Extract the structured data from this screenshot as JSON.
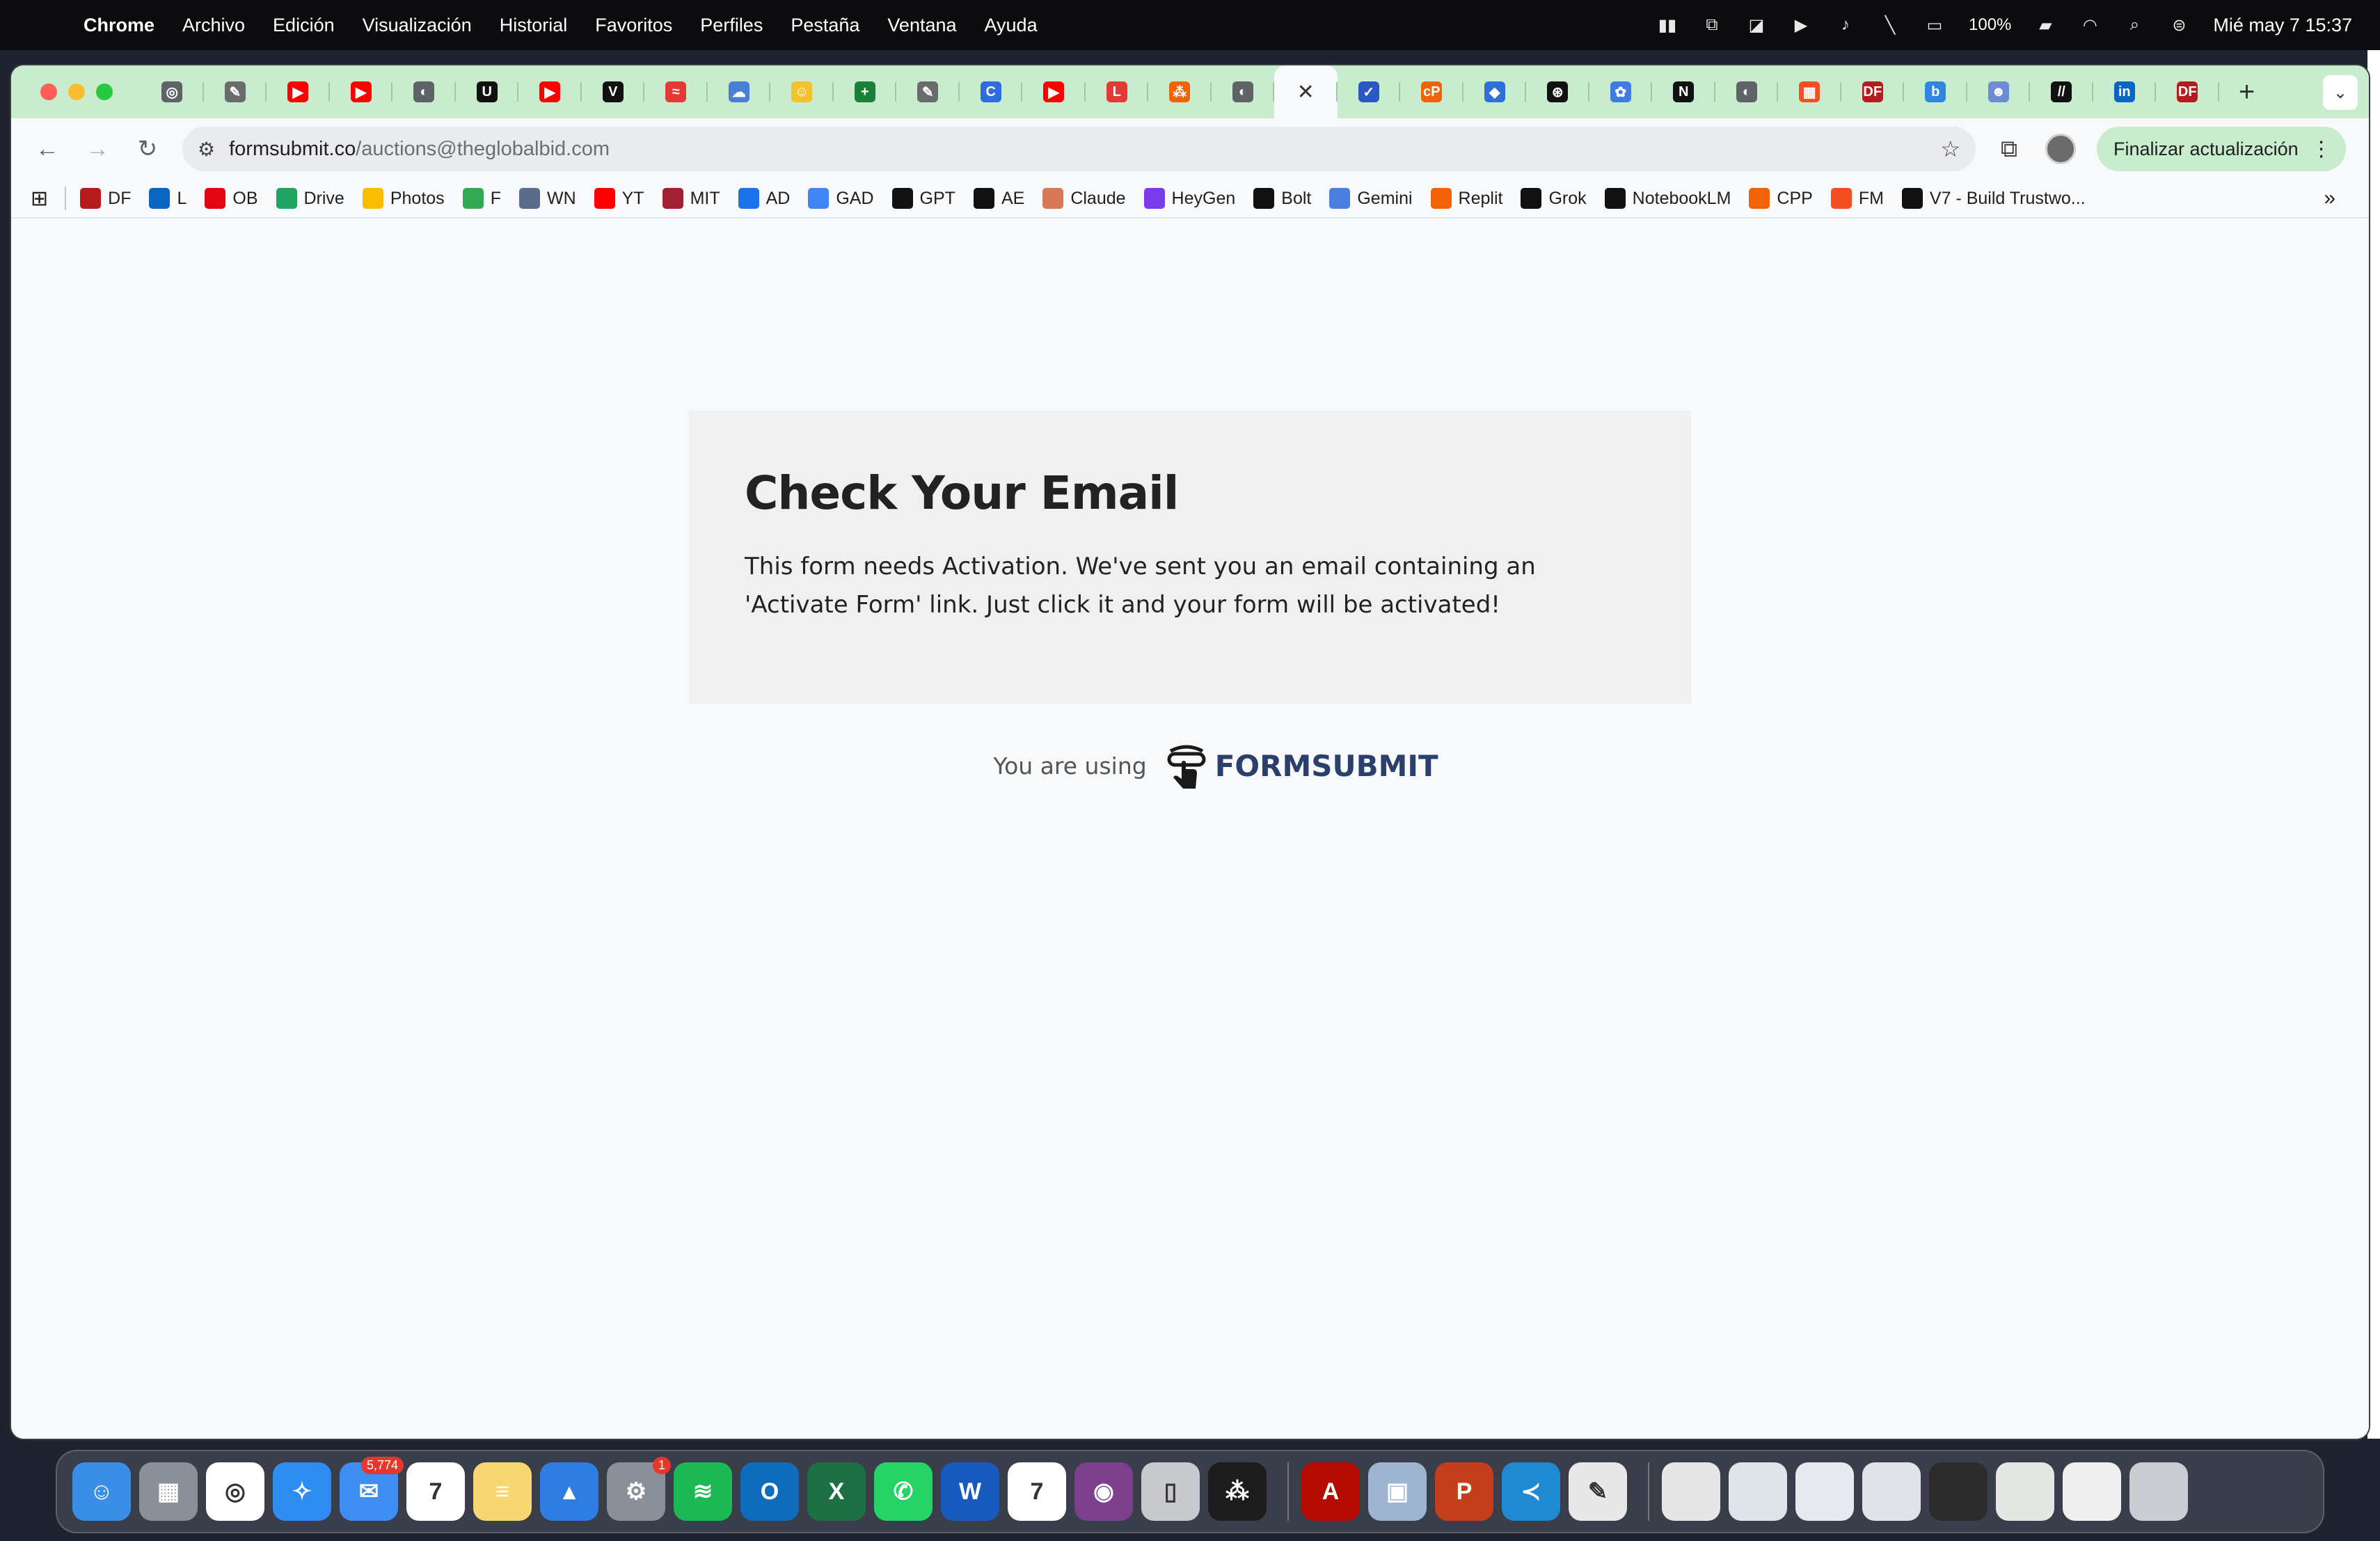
{
  "menubar": {
    "app_name": "Chrome",
    "menus": [
      "Archivo",
      "Edición",
      "Visualización",
      "Historial",
      "Favoritos",
      "Perfiles",
      "Pestaña",
      "Ventana",
      "Ayuda"
    ],
    "battery": "100%",
    "datetime": "Mié may 7  15:37"
  },
  "tabs": [
    {
      "icon": "chrome-icon",
      "color": "#5f6368",
      "glyph": "◎"
    },
    {
      "icon": "puzzle-icon",
      "color": "#6b6b6b",
      "glyph": "✎"
    },
    {
      "icon": "youtube-icon",
      "color": "#ff0000",
      "glyph": "▶"
    },
    {
      "icon": "youtube-icon",
      "color": "#ff0000",
      "glyph": "▶"
    },
    {
      "icon": "globe-icon",
      "color": "#5f6368",
      "glyph": "◐"
    },
    {
      "icon": "u-icon",
      "color": "#111111",
      "glyph": "U"
    },
    {
      "icon": "youtube-icon",
      "color": "#ff0000",
      "glyph": "▶"
    },
    {
      "icon": "v-icon",
      "color": "#111111",
      "glyph": "V"
    },
    {
      "icon": "shark-icon",
      "color": "#e53935",
      "glyph": "≈"
    },
    {
      "icon": "cloud-icon",
      "color": "#4a7fd4",
      "glyph": "☁"
    },
    {
      "icon": "face-icon",
      "color": "#f2c230",
      "glyph": "☺"
    },
    {
      "icon": "sheets-plus-icon",
      "color": "#188038",
      "glyph": "+"
    },
    {
      "icon": "puzzle-icon",
      "color": "#6b6b6b",
      "glyph": "✎"
    },
    {
      "icon": "c-icon",
      "color": "#2e6ce0",
      "glyph": "C"
    },
    {
      "icon": "youtube-icon",
      "color": "#ff0000",
      "glyph": "▶"
    },
    {
      "icon": "l-icon",
      "color": "#e53935",
      "glyph": "L"
    },
    {
      "icon": "replit-icon",
      "color": "#f26207",
      "glyph": "⁂"
    },
    {
      "icon": "globe-icon",
      "color": "#5f6368",
      "glyph": "◐"
    },
    {
      "icon": "close-icon",
      "color": "#333333",
      "glyph": "✕",
      "active": true
    },
    {
      "icon": "check-icon",
      "color": "#2b59c3",
      "glyph": "✓"
    },
    {
      "icon": "cpp-icon",
      "color": "#f26207",
      "glyph": "cP"
    },
    {
      "icon": "stack-icon",
      "color": "#2f6fd8",
      "glyph": "◆"
    },
    {
      "icon": "openai-icon",
      "color": "#111111",
      "glyph": "⊛"
    },
    {
      "icon": "copilot-icon",
      "color": "#3f7be0",
      "glyph": "✿"
    },
    {
      "icon": "n-icon",
      "color": "#111111",
      "glyph": "N"
    },
    {
      "icon": "globe-icon",
      "color": "#5f6368",
      "glyph": "◐"
    },
    {
      "icon": "microsoft-icon",
      "color": "#f25022",
      "glyph": "▦"
    },
    {
      "icon": "df-icon",
      "color": "#b71c1c",
      "glyph": "DF"
    },
    {
      "icon": "b-icon",
      "color": "#2e86de",
      "glyph": "b"
    },
    {
      "icon": "robot-icon",
      "color": "#6c8cd5",
      "glyph": "☻"
    },
    {
      "icon": "slash-icon",
      "color": "#111111",
      "glyph": "//"
    },
    {
      "icon": "linkedin-icon",
      "color": "#0a66c2",
      "glyph": "in"
    },
    {
      "icon": "df-icon",
      "color": "#b71c1c",
      "glyph": "DF"
    }
  ],
  "address_bar": {
    "host": "formsubmit.co",
    "path": "/auctions@theglobalbid.com"
  },
  "update_button": "Finalizar actualización",
  "bookmarks": [
    {
      "label": "DF",
      "icon": "df-icon",
      "color": "#b71c1c"
    },
    {
      "label": "L",
      "icon": "linkedin-icon",
      "color": "#0a66c2"
    },
    {
      "label": "OB",
      "icon": "santander-icon",
      "color": "#e30613"
    },
    {
      "label": "Drive",
      "icon": "drive-icon",
      "color": "#1fa463"
    },
    {
      "label": "Photos",
      "icon": "photos-icon",
      "color": "#fbbc04"
    },
    {
      "label": "F",
      "icon": "f-icon",
      "color": "#34a853"
    },
    {
      "label": "WN",
      "icon": "wn-icon",
      "color": "#5b6b8a"
    },
    {
      "label": "YT",
      "icon": "youtube-icon",
      "color": "#ff0000"
    },
    {
      "label": "MIT",
      "icon": "mit-icon",
      "color": "#a31f34"
    },
    {
      "label": "AD",
      "icon": "ad-icon",
      "color": "#1a73e8"
    },
    {
      "label": "GAD",
      "icon": "google-icon",
      "color": "#4285f4"
    },
    {
      "label": "GPT",
      "icon": "openai-icon",
      "color": "#111111"
    },
    {
      "label": "AE",
      "icon": "ae-icon",
      "color": "#111111"
    },
    {
      "label": "Claude",
      "icon": "claude-icon",
      "color": "#d97757"
    },
    {
      "label": "HeyGen",
      "icon": "heygen-icon",
      "color": "#7c3aed"
    },
    {
      "label": "Bolt",
      "icon": "bolt-icon",
      "color": "#111111"
    },
    {
      "label": "Gemini",
      "icon": "gemini-icon",
      "color": "#4a7fe0"
    },
    {
      "label": "Replit",
      "icon": "replit-icon",
      "color": "#f26207"
    },
    {
      "label": "Grok",
      "icon": "grok-icon",
      "color": "#111111"
    },
    {
      "label": "NotebookLM",
      "icon": "notebooklm-icon",
      "color": "#111111"
    },
    {
      "label": "CPP",
      "icon": "cpp-icon",
      "color": "#f26207"
    },
    {
      "label": "FM",
      "icon": "figma-icon",
      "color": "#f24e1e"
    },
    {
      "label": "V7 - Build Trustwo...",
      "icon": "v7-icon",
      "color": "#111111"
    }
  ],
  "page": {
    "title": "Check Your Email",
    "message": "This form needs Activation. We've sent you an email containing an 'Activate Form' link. Just click it and your form will be activated!",
    "footer_text": "You are using",
    "brand": "FORMSUBMIT",
    "brand_color": "#2a3f6b"
  },
  "dock": [
    {
      "name": "finder",
      "color": "#3a8ee6",
      "glyph": "☺"
    },
    {
      "name": "launchpad",
      "color": "#8a8f99",
      "glyph": "▦"
    },
    {
      "name": "chrome",
      "color": "#ffffff",
      "glyph": "◎"
    },
    {
      "name": "safari",
      "color": "#2f8cf0",
      "glyph": "✧"
    },
    {
      "name": "mail",
      "color": "#3d8ef0",
      "glyph": "✉",
      "badge": "5,774"
    },
    {
      "name": "calendar",
      "color": "#ffffff",
      "glyph": "7"
    },
    {
      "name": "notes",
      "color": "#f7d774",
      "glyph": "≡"
    },
    {
      "name": "keynote",
      "color": "#2f7de0",
      "glyph": "▴"
    },
    {
      "name": "system-settings",
      "color": "#8a8f99",
      "glyph": "⚙",
      "badge": "1"
    },
    {
      "name": "spotify",
      "color": "#1db954",
      "glyph": "≋"
    },
    {
      "name": "outlook",
      "color": "#0f6cbd",
      "glyph": "O"
    },
    {
      "name": "excel",
      "color": "#1d7044",
      "glyph": "X"
    },
    {
      "name": "whatsapp",
      "color": "#25d366",
      "glyph": "✆"
    },
    {
      "name": "word",
      "color": "#185abd",
      "glyph": "W"
    },
    {
      "name": "calendar-7",
      "color": "#ffffff",
      "glyph": "7"
    },
    {
      "name": "screen-recorder",
      "color": "#7b3f8c",
      "glyph": "◉"
    },
    {
      "name": "iphone-mirroring",
      "color": "#c7c9cc",
      "glyph": "▯"
    },
    {
      "name": "replit",
      "color": "#1c1c1c",
      "glyph": "⁂"
    },
    {
      "name": "acrobat",
      "color": "#b30b00",
      "glyph": "A"
    },
    {
      "name": "preview",
      "color": "#9fb4d1",
      "glyph": "▣"
    },
    {
      "name": "powerpoint",
      "color": "#c43e1c",
      "glyph": "P"
    },
    {
      "name": "vscode",
      "color": "#1f8ad2",
      "glyph": "≺"
    },
    {
      "name": "textedit",
      "color": "#e8e8e8",
      "glyph": "✎"
    }
  ],
  "dock_recent": [
    {
      "name": "document-thumbnail",
      "color": "#e6e6e6"
    },
    {
      "name": "window-thumbnail",
      "color": "#dfe3ea"
    },
    {
      "name": "window-thumbnail",
      "color": "#e6e9ee"
    },
    {
      "name": "window-thumbnail",
      "color": "#e0e4ea"
    },
    {
      "name": "window-thumbnail",
      "color": "#2b2b2b"
    },
    {
      "name": "window-thumbnail",
      "color": "#e4e8e4"
    },
    {
      "name": "window-thumbnail",
      "color": "#eeeeee"
    },
    {
      "name": "trash",
      "color": "#c9ccd1"
    }
  ]
}
